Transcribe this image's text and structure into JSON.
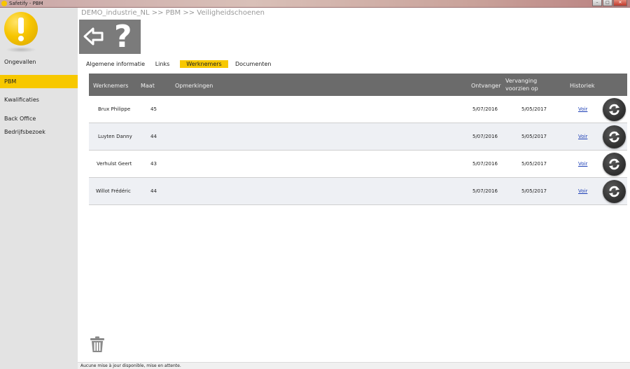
{
  "window": {
    "title": "Safetify - PBM",
    "buttons": [
      "–",
      "□",
      "✕"
    ]
  },
  "sidebar": {
    "logo_icon": "exclamation-icon",
    "items": [
      {
        "label": "Ongevallen",
        "active": false
      },
      {
        "label": "PBM",
        "active": true
      },
      {
        "label": "Kwalificaties",
        "active": false
      },
      {
        "label": "Back Office Bedrijfsbezoek",
        "active": false
      }
    ]
  },
  "header": {
    "breadcrumb": "DEMO_industrie_NL >> PBM >> Veiligheidschoenen",
    "back_icon": "back-arrow-icon",
    "help_label": "?"
  },
  "tabs": [
    {
      "label": "Algemene informatie",
      "active": false
    },
    {
      "label": "Links",
      "active": false
    },
    {
      "label": "Werknemers",
      "active": true
    },
    {
      "label": "Documenten",
      "active": false
    }
  ],
  "table": {
    "columns": {
      "werknemers": "Werknemers",
      "maat": "Maat",
      "opmerkingen": "Opmerkingen",
      "ontvanger": "Ontvanger",
      "vervanging_line1": "Vervanging",
      "vervanging_line2": "voorzien op",
      "historiek": "Historiek"
    },
    "rows": [
      {
        "name": "Brux Philippe",
        "maat": "45",
        "opmerkingen": "",
        "ontvanger": "5/07/2016",
        "vervanging": "5/05/2017",
        "historiek": "Voir"
      },
      {
        "name": "Luyten Danny",
        "maat": "44",
        "opmerkingen": "",
        "ontvanger": "5/07/2016",
        "vervanging": "5/05/2017",
        "historiek": "Voir"
      },
      {
        "name": "Verhulst Geert",
        "maat": "43",
        "opmerkingen": "",
        "ontvanger": "5/07/2016",
        "vervanging": "5/05/2017",
        "historiek": "Voir"
      },
      {
        "name": "Willot Frédéric",
        "maat": "44",
        "opmerkingen": "",
        "ontvanger": "5/07/2016",
        "vervanging": "5/05/2017",
        "historiek": "Voir"
      }
    ]
  },
  "icons": {
    "refresh": "refresh-icon",
    "trash": "trash-icon"
  },
  "statusbar": {
    "text": "Aucune mise à jour disponible, mise en attente."
  },
  "colors": {
    "accent": "#f7c800",
    "header_bg": "#6b6b6b",
    "sidebar_bg": "#e3e3e3"
  }
}
